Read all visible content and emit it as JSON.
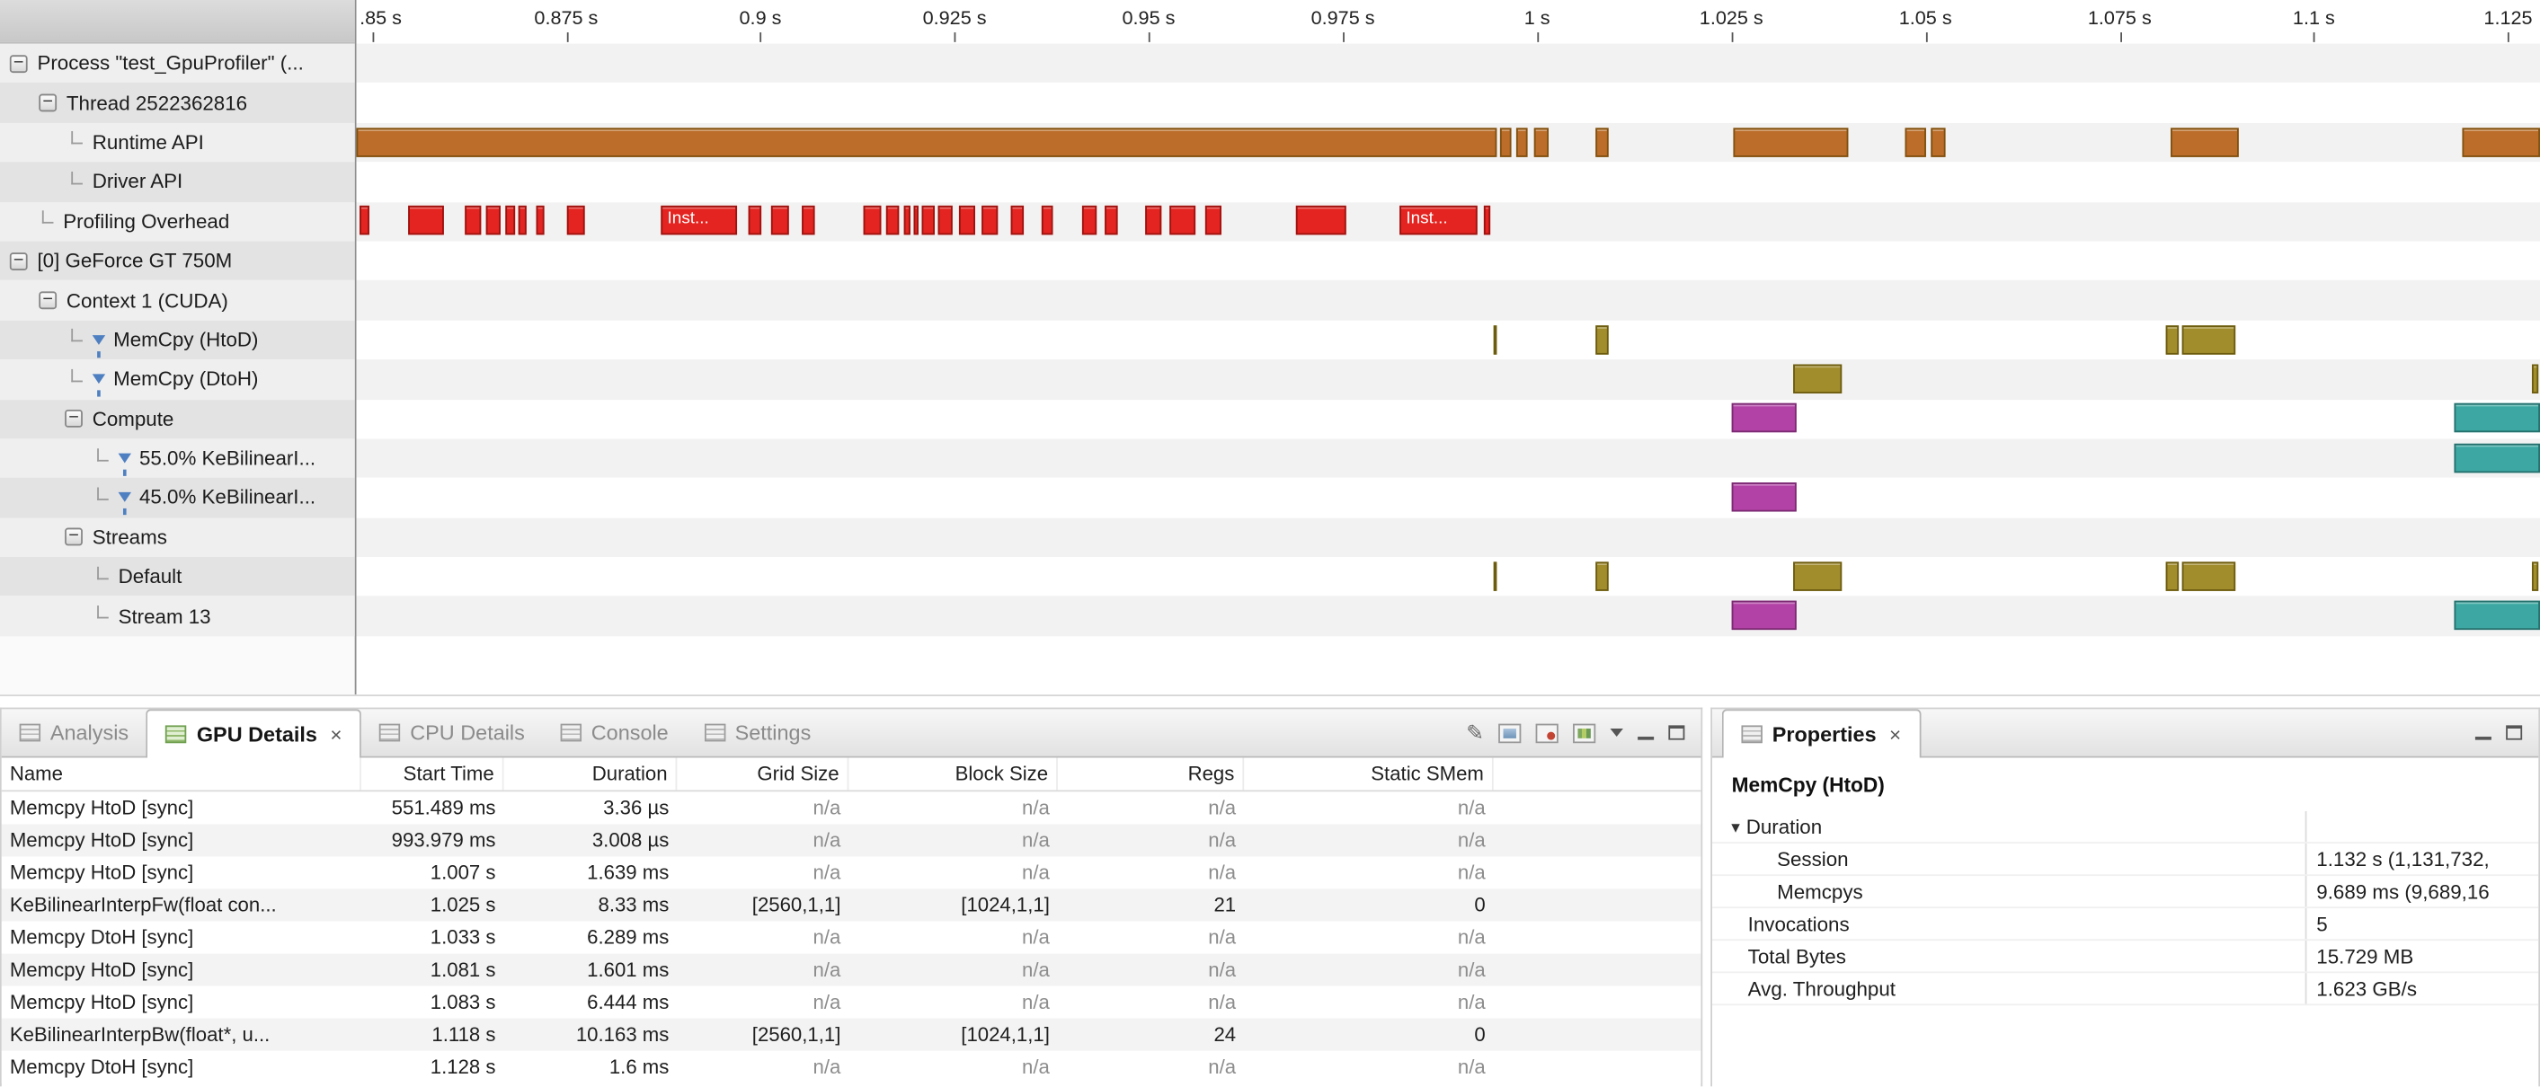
{
  "palette": {
    "orange": {
      "fill": "#bc6d29",
      "border": "#80500f"
    },
    "red": {
      "fill": "#e32420",
      "border": "#9d120f"
    },
    "olive": {
      "fill": "#a28d2d",
      "border": "#6c5c10"
    },
    "magenta": {
      "fill": "#b342a6",
      "border": "#7b2a72"
    },
    "teal": {
      "fill": "#3da8a3",
      "border": "#256f6c"
    }
  },
  "icons": {
    "close": "×",
    "pen": "✎",
    "expander": "▼",
    "collapse": "−"
  },
  "timeline": {
    "ruler": [
      {
        "x": 9.6,
        "label": ".85 s"
      },
      {
        "x": 129.5,
        "label": "0.875 s"
      },
      {
        "x": 249.4,
        "label": "0.9 s"
      },
      {
        "x": 369.3,
        "label": "0.925 s"
      },
      {
        "x": 489.1,
        "label": "0.95 s"
      },
      {
        "x": 609.0,
        "label": "0.975 s"
      },
      {
        "x": 728.9,
        "label": "1 s"
      },
      {
        "x": 848.8,
        "label": "1.025 s"
      },
      {
        "x": 968.6,
        "label": "1.05 s"
      },
      {
        "x": 1088.5,
        "label": "1.075 s"
      },
      {
        "x": 1208.4,
        "label": "1.1 s"
      },
      {
        "x": 1328.3,
        "label": "1.125"
      }
    ],
    "rows": [
      {
        "name": "process",
        "label": "Process \"test_GpuProfiler\" (...",
        "indent": 6,
        "glyph": "minus",
        "filter": false,
        "bars": []
      },
      {
        "name": "thread",
        "label": "Thread 2522362816",
        "indent": 24,
        "glyph": "minus",
        "filter": false,
        "bars": []
      },
      {
        "name": "runtime-api",
        "label": "Runtime API",
        "indent": 44,
        "glyph": "corner",
        "filter": false,
        "bars": [
          [
            0,
            704,
            "orange"
          ],
          [
            706,
            7,
            "orange"
          ],
          [
            716,
            7,
            "orange"
          ],
          [
            727,
            9,
            "orange"
          ],
          [
            765,
            8,
            "orange"
          ],
          [
            850,
            71,
            "orange"
          ],
          [
            956,
            13,
            "orange"
          ],
          [
            972,
            9,
            "orange"
          ],
          [
            1120,
            42,
            "orange"
          ],
          [
            1300,
            48,
            "orange"
          ]
        ]
      },
      {
        "name": "driver-api",
        "label": "Driver API",
        "indent": 44,
        "glyph": "corner",
        "filter": false,
        "bars": []
      },
      {
        "name": "profiling-overhead",
        "label": "Profiling Overhead",
        "indent": 26,
        "glyph": "corner",
        "filter": false,
        "bars": [
          [
            2,
            6,
            "red"
          ],
          [
            32,
            22,
            "red"
          ],
          [
            67,
            10,
            "red"
          ],
          [
            80,
            9,
            "red"
          ],
          [
            92,
            6,
            "red"
          ],
          [
            100,
            5,
            "red"
          ],
          [
            111,
            5,
            "red"
          ],
          [
            130,
            11,
            "red"
          ],
          [
            188,
            47,
            "red",
            "Inst..."
          ],
          [
            242,
            8,
            "red"
          ],
          [
            256,
            11,
            "red"
          ],
          [
            275,
            8,
            "red"
          ],
          [
            313,
            11,
            "red"
          ],
          [
            327,
            8,
            "red"
          ],
          [
            338,
            4,
            "red"
          ],
          [
            344,
            3,
            "red"
          ],
          [
            349,
            8,
            "red"
          ],
          [
            359,
            9,
            "red"
          ],
          [
            372,
            10,
            "red"
          ],
          [
            386,
            10,
            "red"
          ],
          [
            404,
            8,
            "red"
          ],
          [
            423,
            7,
            "red"
          ],
          [
            448,
            9,
            "red"
          ],
          [
            462,
            8,
            "red"
          ],
          [
            487,
            10,
            "red"
          ],
          [
            502,
            16,
            "red"
          ],
          [
            524,
            10,
            "red"
          ],
          [
            580,
            31,
            "red"
          ],
          [
            644,
            48,
            "red",
            "Inst..."
          ],
          [
            696,
            4,
            "red"
          ]
        ]
      },
      {
        "name": "gpu-device",
        "label": "[0] GeForce GT 750M",
        "indent": 6,
        "glyph": "minus",
        "filter": false,
        "bars": []
      },
      {
        "name": "context",
        "label": "Context 1 (CUDA)",
        "indent": 24,
        "glyph": "minus",
        "filter": false,
        "bars": []
      },
      {
        "name": "memcpy-htod",
        "label": "MemCpy (HtoD)",
        "indent": 44,
        "glyph": "corner",
        "filter": true,
        "bars": [
          [
            702,
            2,
            "olive"
          ],
          [
            765,
            8,
            "olive"
          ],
          [
            1117,
            8,
            "olive"
          ],
          [
            1127,
            33,
            "olive"
          ]
        ]
      },
      {
        "name": "memcpy-dtoh",
        "label": "MemCpy (DtoH)",
        "indent": 44,
        "glyph": "corner",
        "filter": true,
        "bars": [
          [
            887,
            30,
            "olive"
          ],
          [
            1343,
            4,
            "olive"
          ]
        ]
      },
      {
        "name": "compute",
        "label": "Compute",
        "indent": 40,
        "glyph": "minus",
        "filter": false,
        "bars": [
          [
            849,
            40,
            "magenta"
          ],
          [
            1295,
            53,
            "teal"
          ]
        ]
      },
      {
        "name": "kernel-55",
        "label": "55.0% KeBilinearI...",
        "indent": 60,
        "glyph": "corner",
        "filter": true,
        "bars": [
          [
            1295,
            53,
            "teal"
          ]
        ]
      },
      {
        "name": "kernel-45",
        "label": "45.0% KeBilinearI...",
        "indent": 60,
        "glyph": "corner",
        "filter": true,
        "bars": [
          [
            849,
            40,
            "magenta"
          ]
        ]
      },
      {
        "name": "streams",
        "label": "Streams",
        "indent": 40,
        "glyph": "minus",
        "filter": false,
        "bars": []
      },
      {
        "name": "default-stream",
        "label": "Default",
        "indent": 60,
        "glyph": "corner",
        "filter": false,
        "bars": [
          [
            702,
            2,
            "olive"
          ],
          [
            765,
            8,
            "olive"
          ],
          [
            887,
            30,
            "olive"
          ],
          [
            1117,
            8,
            "olive"
          ],
          [
            1127,
            33,
            "olive"
          ],
          [
            1343,
            4,
            "olive"
          ]
        ]
      },
      {
        "name": "stream-13",
        "label": "Stream 13",
        "indent": 60,
        "glyph": "corner",
        "filter": false,
        "bars": [
          [
            849,
            40,
            "magenta"
          ],
          [
            1295,
            53,
            "teal"
          ]
        ]
      }
    ]
  },
  "details": {
    "tabs": [
      {
        "label": "Analysis",
        "active": false,
        "closable": false,
        "green": false
      },
      {
        "label": "GPU Details",
        "active": true,
        "closable": true,
        "green": true
      },
      {
        "label": "CPU Details",
        "active": false,
        "closable": false,
        "green": false
      },
      {
        "label": "Console",
        "active": false,
        "closable": false,
        "green": false
      },
      {
        "label": "Settings",
        "active": false,
        "closable": false,
        "green": false
      }
    ],
    "columns": [
      "Name",
      "Start Time",
      "Duration",
      "Grid Size",
      "Block Size",
      "Regs",
      "Static SMem"
    ],
    "rows": [
      [
        "Memcpy HtoD [sync]",
        "551.489 ms",
        "3.36 µs",
        "n/a",
        "n/a",
        "n/a",
        "n/a"
      ],
      [
        "Memcpy HtoD [sync]",
        "993.979 ms",
        "3.008 µs",
        "n/a",
        "n/a",
        "n/a",
        "n/a"
      ],
      [
        "Memcpy HtoD [sync]",
        "1.007 s",
        "1.639 ms",
        "n/a",
        "n/a",
        "n/a",
        "n/a"
      ],
      [
        "KeBilinearInterpFw(float con...",
        "1.025 s",
        "8.33 ms",
        "[2560,1,1]",
        "[1024,1,1]",
        "21",
        "0"
      ],
      [
        "Memcpy DtoH [sync]",
        "1.033 s",
        "6.289 ms",
        "n/a",
        "n/a",
        "n/a",
        "n/a"
      ],
      [
        "Memcpy HtoD [sync]",
        "1.081 s",
        "1.601 ms",
        "n/a",
        "n/a",
        "n/a",
        "n/a"
      ],
      [
        "Memcpy HtoD [sync]",
        "1.083 s",
        "6.444 ms",
        "n/a",
        "n/a",
        "n/a",
        "n/a"
      ],
      [
        "KeBilinearInterpBw(float*, u...",
        "1.118 s",
        "10.163 ms",
        "[2560,1,1]",
        "[1024,1,1]",
        "24",
        "0"
      ],
      [
        "Memcpy DtoH [sync]",
        "1.128 s",
        "1.6 ms",
        "n/a",
        "n/a",
        "n/a",
        "n/a"
      ]
    ]
  },
  "properties": {
    "tab": "Properties",
    "title": "MemCpy (HtoD)",
    "rows": [
      {
        "label": "Duration",
        "value": "",
        "level": 0,
        "expander": true
      },
      {
        "label": "Session",
        "value": "1.132 s (1,131,732,",
        "level": 1,
        "expander": false
      },
      {
        "label": "Memcpys",
        "value": "9.689 ms (9,689,16",
        "level": 1,
        "expander": false
      },
      {
        "label": "Invocations",
        "value": "5",
        "level": 0,
        "expander": false
      },
      {
        "label": "Total Bytes",
        "value": "15.729 MB",
        "level": 0,
        "expander": false
      },
      {
        "label": "Avg. Throughput",
        "value": "1.623 GB/s",
        "level": 0,
        "expander": false
      }
    ]
  }
}
